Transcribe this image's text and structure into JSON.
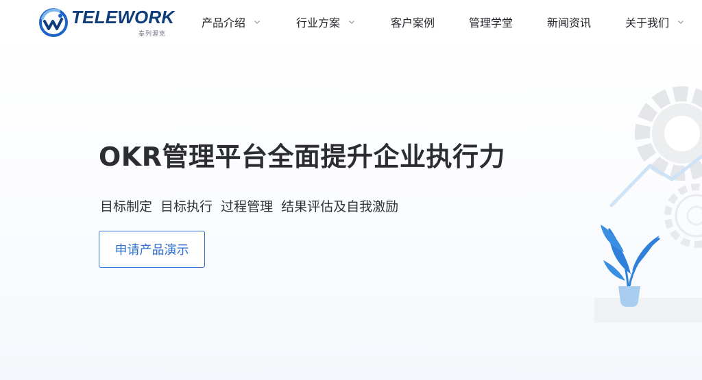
{
  "brand": {
    "name": "TELEWORK",
    "subtitle": "泰列渥克",
    "colors": {
      "primary": "#0f3c7a",
      "accent": "#2f6fd3",
      "light": "#7fb6ee"
    }
  },
  "nav": {
    "items": [
      {
        "label": "产品介绍",
        "has_dropdown": true
      },
      {
        "label": "行业方案",
        "has_dropdown": true
      },
      {
        "label": "客户案例",
        "has_dropdown": false
      },
      {
        "label": "管理学堂",
        "has_dropdown": false
      },
      {
        "label": "新闻资讯",
        "has_dropdown": false
      },
      {
        "label": "关于我们",
        "has_dropdown": true
      }
    ]
  },
  "hero": {
    "title": "OKR管理平台全面提升企业执行力",
    "subtitle": "目标制定 目标执行 过程管理 结果评估及自我激励",
    "cta_label": "申请产品演示"
  },
  "illustration": {
    "icons": [
      "gear-icon",
      "gear-icon",
      "line-chart-icon",
      "plant-icon"
    ]
  }
}
